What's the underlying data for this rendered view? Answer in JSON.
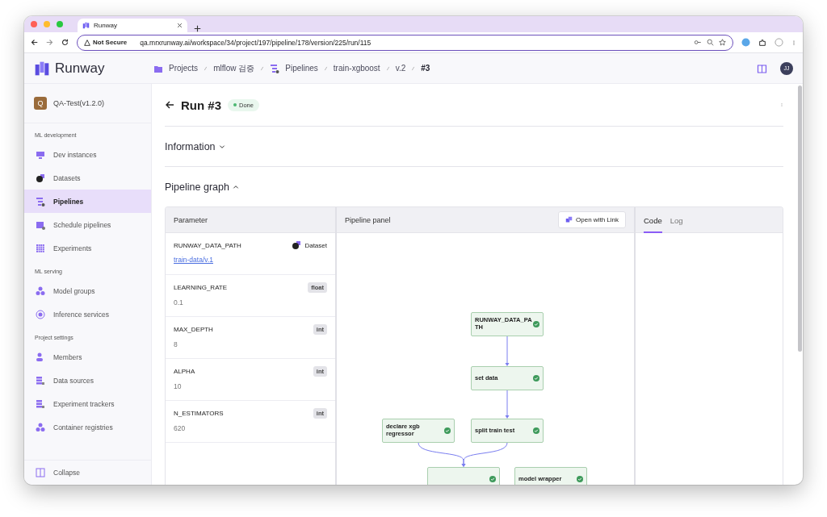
{
  "browser": {
    "tab_title": "Runway",
    "security": "Not Secure",
    "url": "qa.mrxrunway.ai/workspace/34/project/197/pipeline/178/version/225/run/115"
  },
  "app": {
    "logo": "Runway",
    "breadcrumb": [
      {
        "label": "Projects",
        "current": false
      },
      {
        "label": "mlflow 검증",
        "current": false
      },
      {
        "label": "Pipelines",
        "current": false
      },
      {
        "label": "train-xgboost",
        "current": false
      },
      {
        "label": "v.2",
        "current": false
      },
      {
        "label": "#3",
        "current": true
      }
    ],
    "user_initials": "JJ"
  },
  "sidebar": {
    "project": {
      "initial": "Q",
      "name": "QA-Test(v1.2.0)"
    },
    "sections": [
      {
        "title": "ML development",
        "items": [
          {
            "label": "Dev instances",
            "selected": false
          },
          {
            "label": "Datasets",
            "selected": false
          },
          {
            "label": "Pipelines",
            "selected": true
          },
          {
            "label": "Schedule pipelines",
            "selected": false
          },
          {
            "label": "Experiments",
            "selected": false
          }
        ]
      },
      {
        "title": "ML serving",
        "items": [
          {
            "label": "Model groups",
            "selected": false
          },
          {
            "label": "Inference services",
            "selected": false
          }
        ]
      },
      {
        "title": "Project settings",
        "items": [
          {
            "label": "Members",
            "selected": false
          },
          {
            "label": "Data sources",
            "selected": false
          },
          {
            "label": "Experiment trackers",
            "selected": false
          },
          {
            "label": "Container registries",
            "selected": false
          }
        ]
      }
    ],
    "collapse": "Collapse"
  },
  "run": {
    "title": "Run #3",
    "status": "Done"
  },
  "sections": [
    {
      "title": "Information",
      "expanded": false
    },
    {
      "title": "Pipeline graph",
      "expanded": true
    }
  ],
  "parameter_panel": {
    "title": "Parameter",
    "rows": [
      {
        "name": "RUNWAY_DATA_PATH",
        "kind": "dataset",
        "type": "Dataset",
        "value": "train-data/v.1"
      },
      {
        "name": "LEARNING_RATE",
        "kind": "plain",
        "type": "float",
        "value": "0.1"
      },
      {
        "name": "MAX_DEPTH",
        "kind": "plain",
        "type": "int",
        "value": "8"
      },
      {
        "name": "ALPHA",
        "kind": "plain",
        "type": "int",
        "value": "10"
      },
      {
        "name": "N_ESTIMATORS",
        "kind": "plain",
        "type": "int",
        "value": "620"
      }
    ]
  },
  "pipeline_panel": {
    "title": "Pipeline panel",
    "open_button": "Open with Link",
    "nodes": [
      {
        "label": "RUNWAY_DATA_PA TH",
        "done": true
      },
      {
        "label": "set data",
        "done": true
      },
      {
        "label": "declare xgb regressor",
        "done": true
      },
      {
        "label": "split train test",
        "done": true
      },
      {
        "done": true
      },
      {
        "label": "model wrapper",
        "done": true
      }
    ]
  },
  "output_tabs": [
    {
      "label": "Code",
      "selected": true
    },
    {
      "label": "Log",
      "selected": false
    }
  ]
}
